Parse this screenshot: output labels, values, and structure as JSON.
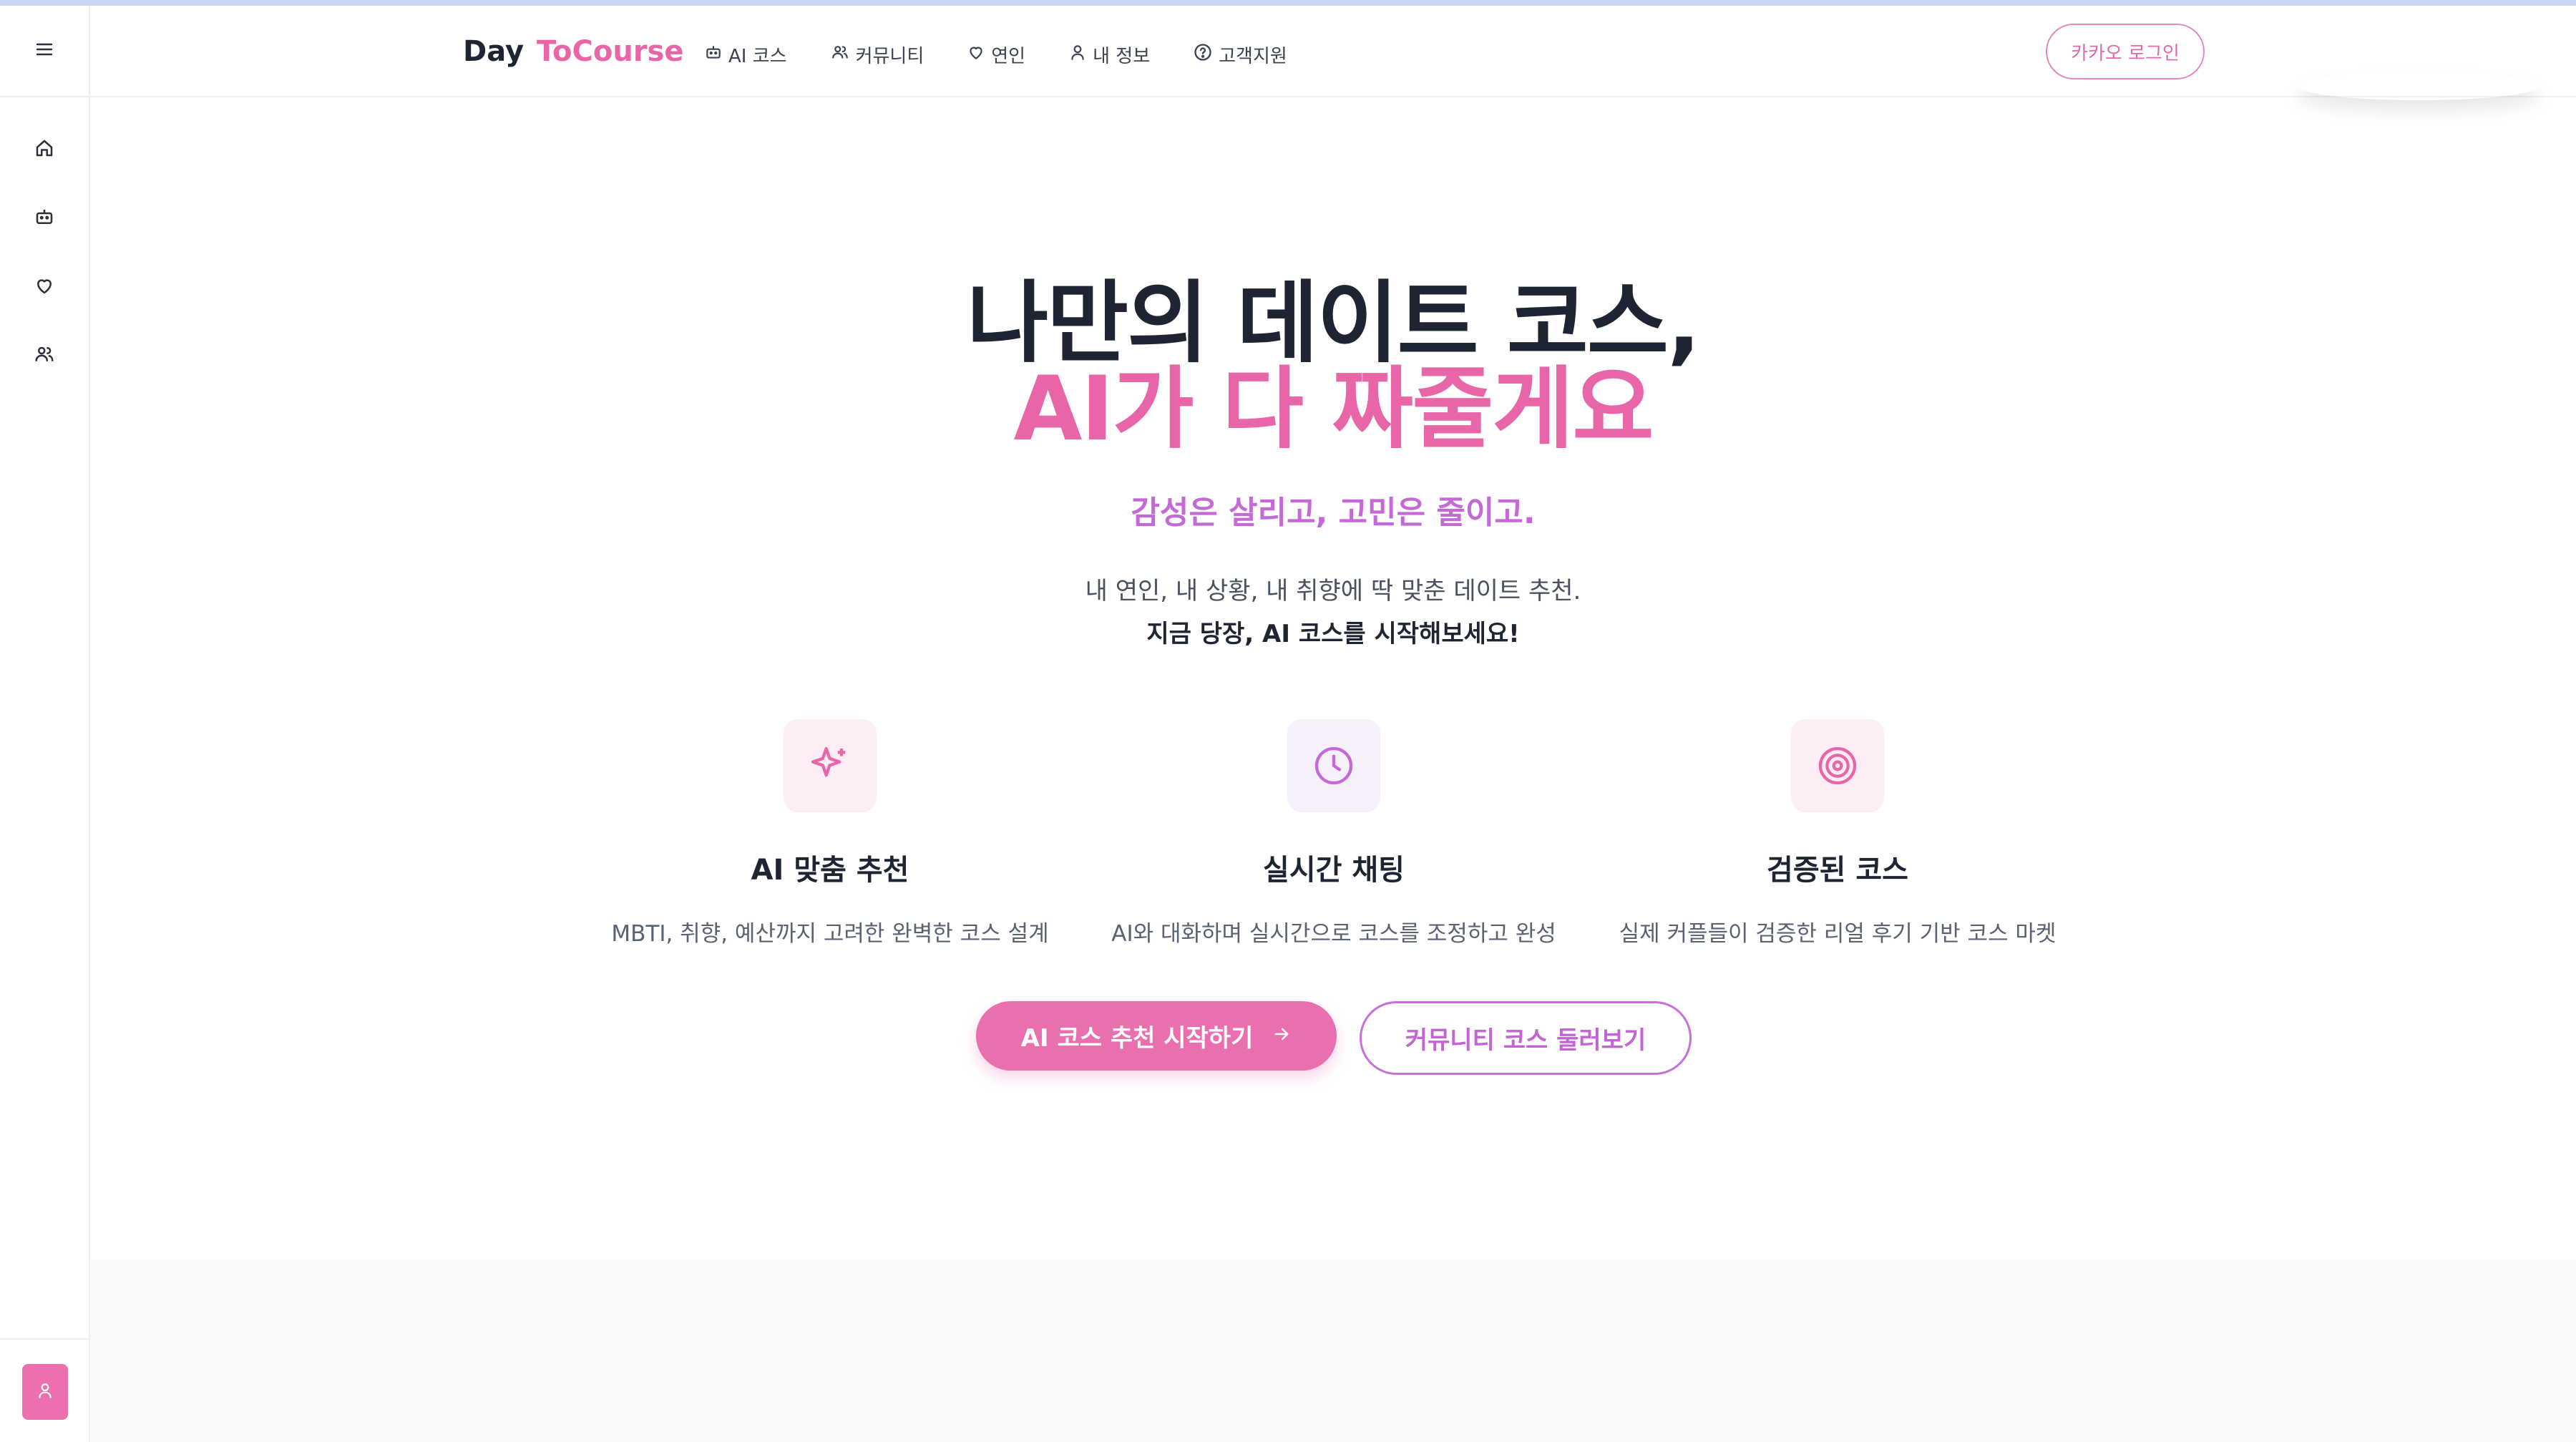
{
  "header": {
    "logo_day": "Day",
    "logo_to": "ToCourse",
    "nav": [
      {
        "label": "AI 코스",
        "icon": "robot-icon"
      },
      {
        "label": "커뮤니티",
        "icon": "users-icon"
      },
      {
        "label": "연인",
        "icon": "heart-icon"
      },
      {
        "label": "내 정보",
        "icon": "user-icon"
      },
      {
        "label": "고객지원",
        "icon": "help-circle-icon"
      }
    ],
    "login_label": "카카오 로그인"
  },
  "sidebar": {
    "items": [
      {
        "icon": "home-icon"
      },
      {
        "icon": "robot-icon"
      },
      {
        "icon": "heart-icon"
      },
      {
        "icon": "users-icon"
      }
    ]
  },
  "hero": {
    "title_line1": "나만의 데이트 코스,",
    "title_line2": "AI가 다 짜줄게요",
    "tagline": "감성은 살리고, 고민은 줄이고.",
    "desc1": "내 연인, 내 상황, 내 취향에 딱 맞춘 데이트 추천.",
    "desc2": "지금 당장, AI 코스를 시작해보세요!"
  },
  "features": [
    {
      "title": "AI 맞춤 추천",
      "desc": "MBTI, 취향, 예산까지 고려한 완벽한 코스 설계",
      "icon": "sparkles-icon"
    },
    {
      "title": "실시간 채팅",
      "desc": "AI와 대화하며 실시간으로 코스를 조정하고 완성",
      "icon": "clock-icon"
    },
    {
      "title": "검증된 코스",
      "desc": "실제 커플들이 검증한 리얼 후기 기반 코스 마켓",
      "icon": "target-icon"
    }
  ],
  "cta": {
    "primary": "AI 코스 추천 시작하기",
    "secondary": "커뮤니티 코스 둘러보기"
  },
  "colors": {
    "brand_pink": "#e865a8",
    "purple": "#c46ad6",
    "text_dark": "#1f2433"
  }
}
